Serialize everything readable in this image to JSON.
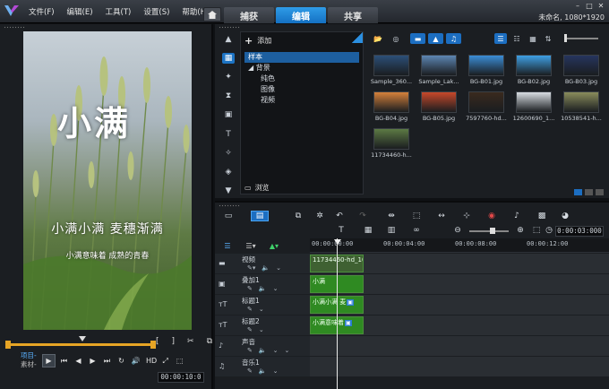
{
  "menu": {
    "items": [
      "文件(F)",
      "编辑(E)",
      "工具(T)",
      "设置(S)",
      "帮助(H)"
    ]
  },
  "tabs": [
    "捕获",
    "编辑",
    "共享"
  ],
  "active_tab": "编辑",
  "project_name": "未命名, 1080*1920",
  "player": {
    "title_text": "小满",
    "subtitle_text": "小满小满 麦穗渐满",
    "line_text": "小满意味着 成熟的青春",
    "mode_project": "项目-",
    "mode_clip": "素材-",
    "hd_label": "HD",
    "timecode": "00:00:10:0"
  },
  "library": {
    "add_label": "添加",
    "tree": {
      "selected": "样本",
      "parent": "背景",
      "children": [
        "纯色",
        "图像",
        "视频"
      ]
    },
    "browse_label": "浏览",
    "thumbnails": [
      {
        "label": "Sample_360...",
        "color": "#2c4f78"
      },
      {
        "label": "Sample_Lak...",
        "color": "#5d86b2"
      },
      {
        "label": "BG-B01.jpg",
        "color": "#3b8dd6"
      },
      {
        "label": "BG-B02.jpg",
        "color": "#3fa0e4"
      },
      {
        "label": "BG-B03.jpg",
        "color": "#26355e"
      },
      {
        "label": "BG-B04.jpg",
        "color": "#d5813b"
      },
      {
        "label": "BG-B05.jpg",
        "color": "#c7482a"
      },
      {
        "label": "7597760-hd...",
        "color": "#3a2a1e"
      },
      {
        "label": "12600690_1...",
        "color": "#d8dde2"
      },
      {
        "label": "10538541-h...",
        "color": "#8a8d5c"
      },
      {
        "label": "11734460-h...",
        "color": "#5c7a44"
      }
    ]
  },
  "timeline": {
    "timecode": "0:00:03:000",
    "ruler": [
      "00:00:00:00",
      "00:00:04:00",
      "00:00:08:00",
      "00:00:12:00"
    ],
    "tracks": [
      {
        "name": "视频",
        "icon": "video-track-icon"
      },
      {
        "name": "叠加1",
        "icon": "overlay-track-icon"
      },
      {
        "name": "标题1",
        "icon": "title-track-icon"
      },
      {
        "name": "标题2",
        "icon": "title-track-icon"
      },
      {
        "name": "声音",
        "icon": "voice-track-icon"
      },
      {
        "name": "音乐1",
        "icon": "music-track-icon"
      }
    ],
    "clips": {
      "video": "11734460-hd_10",
      "overlay": "小满",
      "title1": "小满小满 麦",
      "title2": "小满意味着"
    }
  },
  "colors": {
    "accent": "#1c6ec1",
    "active_tab": "#2f9ce8",
    "clip_green": "#2f8a22",
    "scrub_orange": "#e6a425"
  }
}
